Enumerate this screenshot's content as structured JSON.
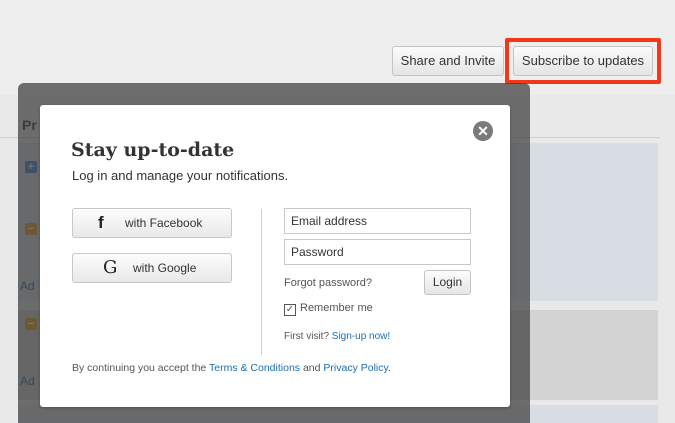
{
  "header": {
    "share_label": "Share and Invite",
    "subscribe_label": "Subscribe to updates",
    "highlight_color": "#f3371b"
  },
  "background": {
    "section_label": "Pr",
    "row_label_1": "Ad",
    "row_label_2": "Ad"
  },
  "modal": {
    "close_icon": "close-circle-icon",
    "title": "Stay up-to-date",
    "subtitle": "Log in and manage your notifications.",
    "facebook": {
      "glyph": "f",
      "label": "with Facebook"
    },
    "google": {
      "glyph": "G",
      "label": "with Google"
    },
    "email_placeholder": "Email address",
    "password_placeholder": "Password",
    "forgot_label": "Forgot password?",
    "login_label": "Login",
    "remember_label": "Remember me",
    "remember_checked": true,
    "first_visit_prefix": "First visit?",
    "signup_label": "Sign-up now!",
    "terms_prefix": "By continuing you accept the",
    "terms_link": "Terms & Conditions",
    "terms_and": "and",
    "privacy_link": "Privacy Policy",
    "terms_suffix": ".",
    "link_color": "#1b6fb5"
  }
}
